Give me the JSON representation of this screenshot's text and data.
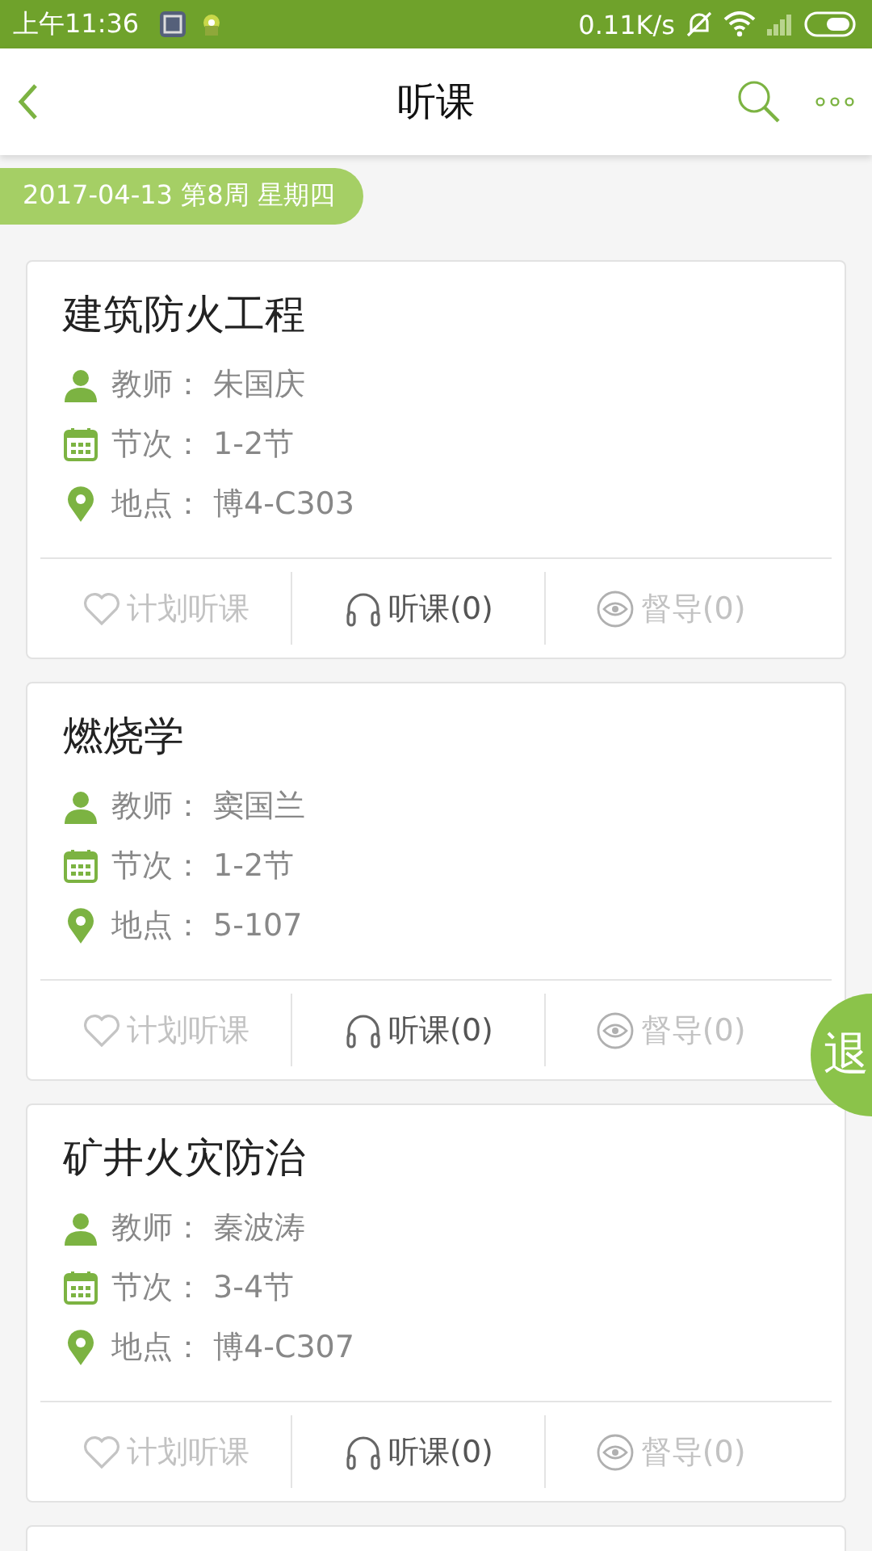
{
  "status_bar": {
    "time": "上午11:36",
    "speed": "0.11K/s"
  },
  "header": {
    "title": "听课"
  },
  "date_tag": "2017-04-13 第8周 星期四",
  "courses": [
    {
      "name": "建筑防火工程",
      "teacher_label": "教师：",
      "teacher": "朱国庆",
      "period_label": "节次：",
      "period": "1-2节",
      "place_label": "地点：",
      "place": "博4-C303",
      "actions": [
        {
          "kind": "plan",
          "label": "计划听课",
          "disabled": true
        },
        {
          "kind": "listen",
          "label": "听课(0)",
          "disabled": false
        },
        {
          "kind": "supervise",
          "label": "督导(0)",
          "disabled": true
        }
      ]
    },
    {
      "name": "燃烧学",
      "teacher_label": "教师：",
      "teacher": "窦国兰",
      "period_label": "节次：",
      "period": "1-2节",
      "place_label": "地点：",
      "place": "5-107",
      "actions": [
        {
          "kind": "plan",
          "label": "计划听课",
          "disabled": true
        },
        {
          "kind": "listen",
          "label": "听课(0)",
          "disabled": false
        },
        {
          "kind": "supervise",
          "label": "督导(0)",
          "disabled": true
        }
      ]
    },
    {
      "name": "矿井火灾防治",
      "teacher_label": "教师：",
      "teacher": "秦波涛",
      "period_label": "节次：",
      "period": "3-4节",
      "place_label": "地点：",
      "place": "博4-C307",
      "actions": [
        {
          "kind": "plan",
          "label": "计划听课",
          "disabled": true
        },
        {
          "kind": "listen",
          "label": "听课(0)",
          "disabled": false
        },
        {
          "kind": "supervise",
          "label": "督导(0)",
          "disabled": true
        }
      ]
    }
  ],
  "float_button": "退"
}
